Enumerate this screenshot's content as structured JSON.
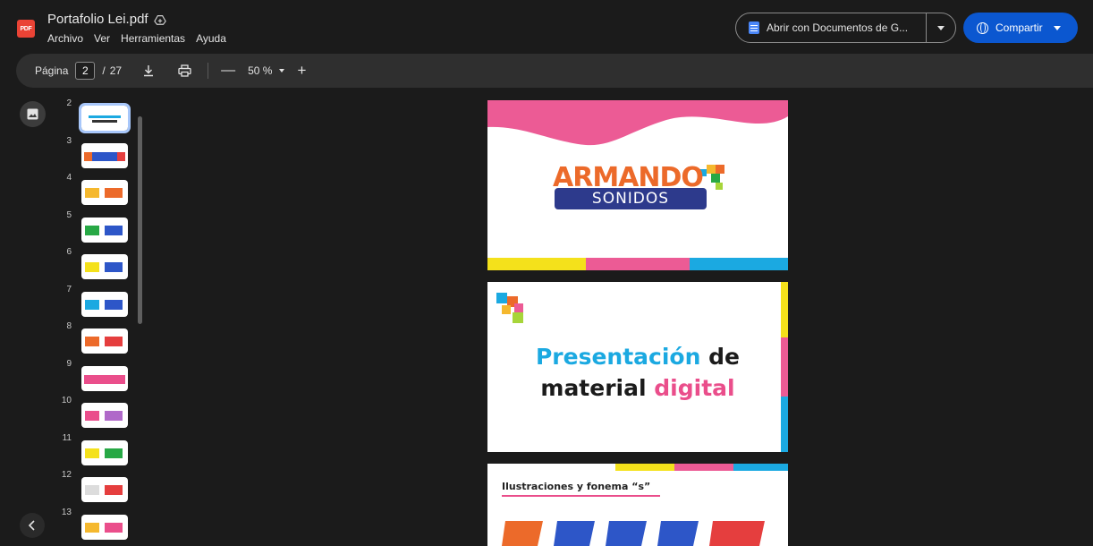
{
  "header": {
    "file_badge": "PDF",
    "title": "Portafolio Lei.pdf",
    "menu": [
      "Archivo",
      "Ver",
      "Herramientas",
      "Ayuda"
    ],
    "open_with_label": "Abrir con Documentos de G...",
    "share_label": "Compartir"
  },
  "toolbar": {
    "page_label": "Página",
    "current_page": "2",
    "separator": "/",
    "total_pages": "27",
    "zoom_minus": "—",
    "zoom_value": "50 %",
    "zoom_plus": "+"
  },
  "thumbnails": [
    {
      "page": "2",
      "active": true
    },
    {
      "page": "3"
    },
    {
      "page": "4"
    },
    {
      "page": "5"
    },
    {
      "page": "6"
    },
    {
      "page": "7"
    },
    {
      "page": "8"
    },
    {
      "page": "9"
    },
    {
      "page": "10"
    },
    {
      "page": "11"
    },
    {
      "page": "12"
    },
    {
      "page": "13"
    }
  ],
  "slides": {
    "slide1": {
      "logo_top": "ARMANDO",
      "logo_bottom": "SONIDOS"
    },
    "slide2": {
      "word1": "Presentación",
      "word2": "de",
      "word3": "material",
      "word4": "digital"
    },
    "slide3": {
      "title": "Ilustraciones y fonema “s”"
    }
  },
  "colors": {
    "accent_blue": "#0b57d0",
    "pink": "#ea4e8b",
    "yellow": "#f4e11b",
    "light_blue": "#1ba9e1",
    "navy": "#2d3a8c"
  }
}
